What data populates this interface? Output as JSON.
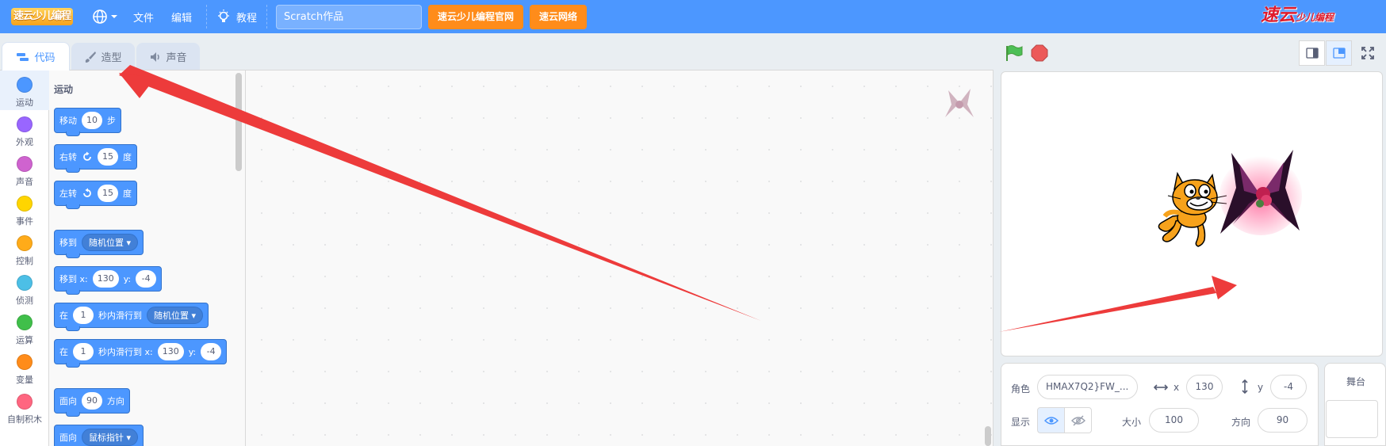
{
  "menubar": {
    "logo_text": "速云少儿编程",
    "file": "文件",
    "edit": "编辑",
    "tutorial": "教程",
    "project_title": "Scratch作品",
    "btn_official": "速云少儿编程官网",
    "btn_network": "速云网络",
    "brand_main": "速云",
    "brand_sub": "少儿编程",
    "brand_color": "#e01b2b",
    "accent": "#4c97ff"
  },
  "tabs": [
    {
      "label": "代码",
      "icon": "code-icon",
      "active": true
    },
    {
      "label": "造型",
      "icon": "brush-icon",
      "active": false
    },
    {
      "label": "声音",
      "icon": "speaker-icon",
      "active": false
    }
  ],
  "categories": [
    {
      "label": "运动",
      "color": "#4c97ff"
    },
    {
      "label": "外观",
      "color": "#9966ff"
    },
    {
      "label": "声音",
      "color": "#cf63cf"
    },
    {
      "label": "事件",
      "color": "#ffd500"
    },
    {
      "label": "控制",
      "color": "#ffab19"
    },
    {
      "label": "侦测",
      "color": "#4cbfe6"
    },
    {
      "label": "运算",
      "color": "#40bf4a"
    },
    {
      "label": "变量",
      "color": "#ff8c1a"
    },
    {
      "label": "自制积木",
      "color": "#ff6680"
    }
  ],
  "palette": {
    "title": "运动",
    "blocks": {
      "move": {
        "a": "移动",
        "v": "10",
        "b": "步"
      },
      "turn_right": {
        "a": "右转",
        "v": "15",
        "b": "度"
      },
      "turn_left": {
        "a": "左转",
        "v": "15",
        "b": "度"
      },
      "goto": {
        "a": "移到",
        "opt": "随机位置"
      },
      "goto_xy": {
        "a": "移到 x:",
        "x": "130",
        "ylbl": "y:",
        "y": "-4"
      },
      "glide": {
        "a": "在",
        "v": "1",
        "b": "秒内滑行到",
        "opt": "随机位置"
      },
      "glide_xy": {
        "a": "在",
        "v": "1",
        "b": "秒内滑行到 x:",
        "x": "130",
        "ylbl": "y:",
        "y": "-4"
      },
      "point": {
        "a": "面向",
        "v": "90",
        "b": "方向"
      },
      "point_towards": {
        "a": "面向",
        "opt": "鼠标指针"
      }
    }
  },
  "sprite_info": {
    "sprite_label": "角色",
    "sprite_name": "HMAX7Q2}FW_...",
    "x_label": "x",
    "x": "130",
    "y_label": "y",
    "y": "-4",
    "show_label": "显示",
    "size_label": "大小",
    "size": "100",
    "direction_label": "方向",
    "direction": "90"
  },
  "stage_panel": {
    "title": "舞台"
  }
}
